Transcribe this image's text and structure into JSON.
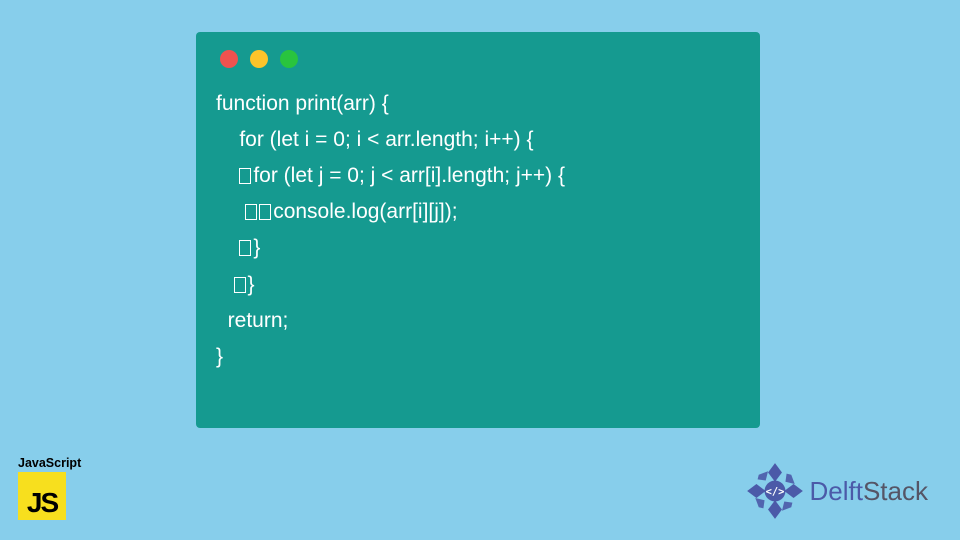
{
  "code": {
    "line1": "function print(arr) {",
    "line2_a": "    for (let i = 0; i < arr.length; i++) {",
    "line3_a": "    ",
    "line3_b": "for (let j = 0; j < arr[i].length; j++) {",
    "line4_a": "     ",
    "line4_b": "console.log(arr[i][j]);",
    "line5_a": "    ",
    "line5_b": "}",
    "line6_a": "   ",
    "line6_b": "}",
    "line7_a": "  return;",
    "line8_a": "}"
  },
  "badge": {
    "label": "JavaScript",
    "logo_text": "JS"
  },
  "brand": {
    "name_first": "Delft",
    "name_rest": "Stack"
  },
  "colors": {
    "bg": "#87ceeb",
    "window": "#159a90",
    "js": "#f7df1e"
  }
}
